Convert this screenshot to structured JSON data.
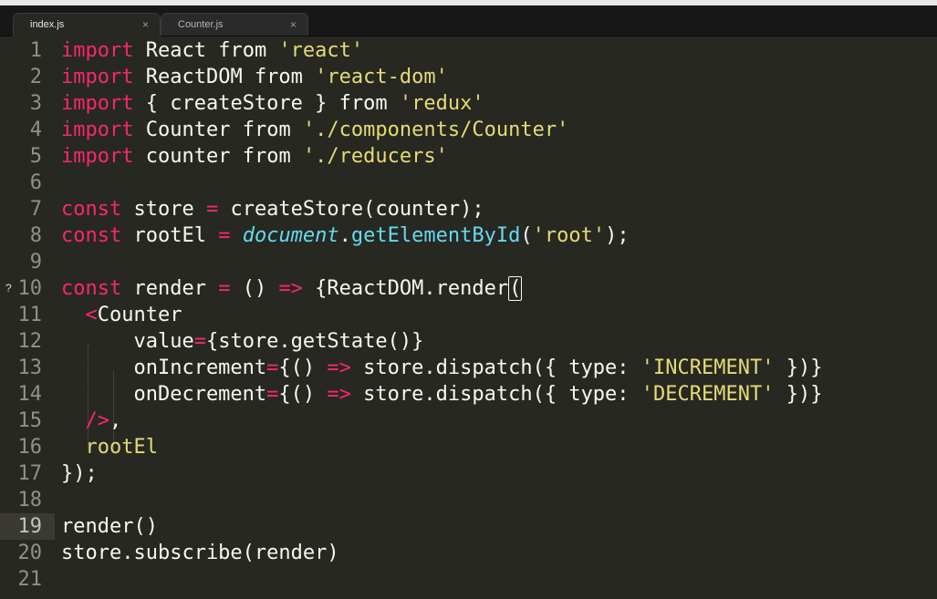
{
  "tabs": [
    {
      "label": "index.js",
      "close": "×",
      "active": true
    },
    {
      "label": "Counter.js",
      "close": "×",
      "active": false
    }
  ],
  "editor": {
    "current_line": 19,
    "lines": [
      {
        "n": "1",
        "tokens": [
          [
            "kw",
            "import"
          ],
          [
            "t",
            " React "
          ],
          [
            "t",
            "from "
          ],
          [
            "str",
            "'react'"
          ]
        ]
      },
      {
        "n": "2",
        "tokens": [
          [
            "kw",
            "import"
          ],
          [
            "t",
            " ReactDOM "
          ],
          [
            "t",
            "from "
          ],
          [
            "str",
            "'react-dom'"
          ]
        ]
      },
      {
        "n": "3",
        "tokens": [
          [
            "kw",
            "import"
          ],
          [
            "t",
            " { createStore } "
          ],
          [
            "t",
            "from "
          ],
          [
            "str",
            "'redux'"
          ]
        ]
      },
      {
        "n": "4",
        "tokens": [
          [
            "kw",
            "import"
          ],
          [
            "t",
            " Counter "
          ],
          [
            "t",
            "from "
          ],
          [
            "str",
            "'./components/Counter'"
          ]
        ]
      },
      {
        "n": "5",
        "tokens": [
          [
            "kw",
            "import"
          ],
          [
            "t",
            " counter "
          ],
          [
            "t",
            "from "
          ],
          [
            "str",
            "'./reducers'"
          ]
        ]
      },
      {
        "n": "6",
        "tokens": []
      },
      {
        "n": "7",
        "tokens": [
          [
            "kw",
            "const"
          ],
          [
            "t",
            " store "
          ],
          [
            "kw",
            "="
          ],
          [
            "t",
            " createStore(counter);"
          ]
        ]
      },
      {
        "n": "8",
        "tokens": [
          [
            "kw",
            "const"
          ],
          [
            "t",
            " rootEl "
          ],
          [
            "kw",
            "="
          ],
          [
            "t",
            " "
          ],
          [
            "fn",
            "document"
          ],
          [
            "t",
            "."
          ],
          [
            "call",
            "getElementById"
          ],
          [
            "t",
            "("
          ],
          [
            "str",
            "'root'"
          ],
          [
            "t",
            ");"
          ]
        ]
      },
      {
        "n": "9",
        "tokens": []
      },
      {
        "n": "10",
        "marker": "?",
        "tokens": [
          [
            "kw",
            "const"
          ],
          [
            "t",
            " render "
          ],
          [
            "kw",
            "="
          ],
          [
            "t",
            " () "
          ],
          [
            "kw",
            "=>"
          ],
          [
            "t",
            " {ReactDOM.render"
          ],
          [
            "bracket",
            "("
          ]
        ]
      },
      {
        "n": "11",
        "tokens": [
          [
            "t",
            "  "
          ],
          [
            "tag",
            "<"
          ],
          [
            "t",
            "Counter"
          ]
        ]
      },
      {
        "n": "12",
        "tokens": [
          [
            "t",
            "      value"
          ],
          [
            "kw",
            "="
          ],
          [
            "t",
            "{store.getState()}"
          ]
        ]
      },
      {
        "n": "13",
        "tokens": [
          [
            "t",
            "      onIncrement"
          ],
          [
            "kw",
            "="
          ],
          [
            "t",
            "{() "
          ],
          [
            "kw",
            "=>"
          ],
          [
            "t",
            " store.dispatch({ type: "
          ],
          [
            "str",
            "'INCREMENT'"
          ],
          [
            "t",
            " })}"
          ]
        ]
      },
      {
        "n": "14",
        "tokens": [
          [
            "t",
            "      onDecrement"
          ],
          [
            "kw",
            "="
          ],
          [
            "t",
            "{() "
          ],
          [
            "kw",
            "=>"
          ],
          [
            "t",
            " store.dispatch({ type: "
          ],
          [
            "str",
            "'DECREMENT'"
          ],
          [
            "t",
            " })}"
          ]
        ]
      },
      {
        "n": "15",
        "tokens": [
          [
            "t",
            "  "
          ],
          [
            "tag",
            "/>"
          ],
          [
            "t",
            ","
          ]
        ]
      },
      {
        "n": "16",
        "tokens": [
          [
            "t",
            "  "
          ],
          [
            "str",
            "rootEl"
          ]
        ]
      },
      {
        "n": "17",
        "tokens": [
          [
            "t",
            "});"
          ]
        ]
      },
      {
        "n": "18",
        "tokens": []
      },
      {
        "n": "19",
        "tokens": [
          [
            "t",
            "render()"
          ]
        ]
      },
      {
        "n": "20",
        "tokens": [
          [
            "t",
            "store.subscribe(render)"
          ]
        ]
      },
      {
        "n": "21",
        "tokens": []
      }
    ]
  },
  "colors": {
    "background": "#272822",
    "keyword": "#f92672",
    "string": "#e6db74",
    "function": "#66d9ef",
    "text": "#f8f8f2"
  }
}
